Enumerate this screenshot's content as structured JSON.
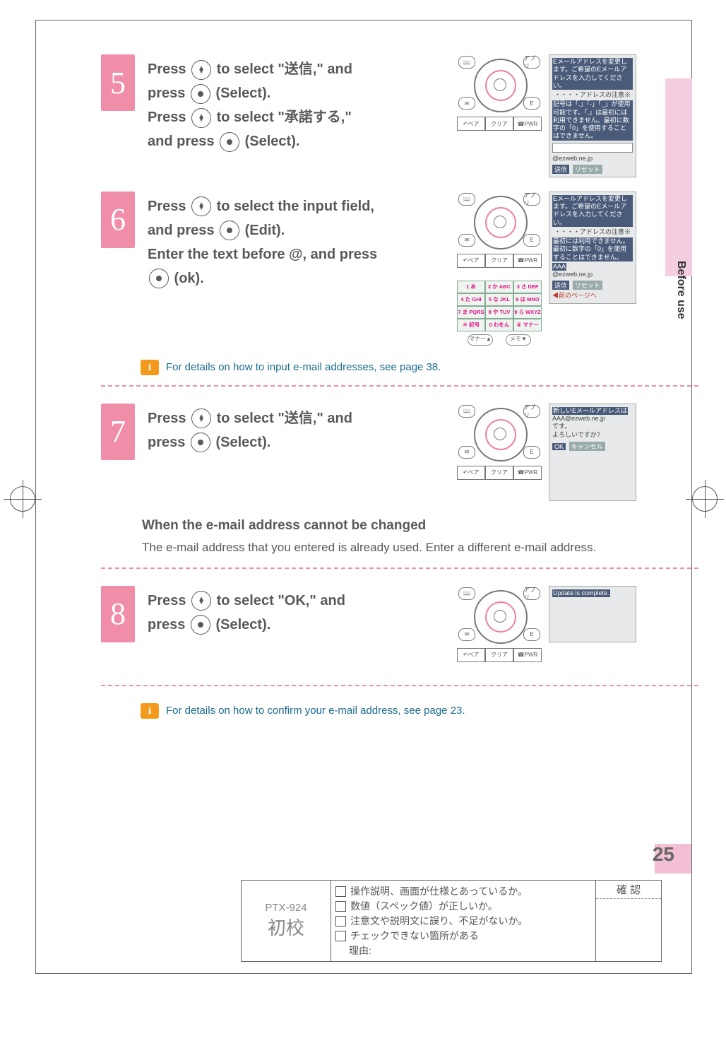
{
  "sideTab": "Before use",
  "pageNumber": "25",
  "steps": {
    "5": {
      "num": "5",
      "lines": [
        "Press |arrows| to select \"送信,\" and",
        "press |dot| (Select).",
        "Press |arrows| to select \"承諾する,\"",
        "and press |dot| (Select)."
      ],
      "screen": {
        "top": "Eメールアドレスを変更します。ご希望のEメールアドレスを入力してください。",
        "band": "・・・・アドレスの注意※",
        "mid": "記号は「.」「-」「_」が使用可能です。「.」は最初には利用できません。最初に数字の「0」を使用することはできません。",
        "domain": "@ezweb.ne.jp",
        "buttons": [
          "送信",
          "リセット"
        ]
      }
    },
    "6": {
      "num": "6",
      "lines": [
        "Press |arrows| to select the input field,",
        "and press |dot| (Edit).",
        "Enter the text before @, and press",
        "|dot| (ok)."
      ],
      "screen": {
        "top": "Eメールアドレスを変更します。ご希望のEメールアドレスを入力してください。",
        "band": "・・・・アドレスの注意※",
        "mid": "最初には利用できません。最初に数字の「0」を使用することはできません。",
        "input": "AAA",
        "domain": "@ezweb.ne.jp",
        "buttons": [
          "送信",
          "リセット"
        ],
        "link": "◀前のページへ"
      },
      "note": "For details on how to input e-mail addresses, see page 38."
    },
    "7": {
      "num": "7",
      "lines": [
        "Press |arrows| to select \"送信,\" and",
        "press |dot| (Select)."
      ],
      "screen": {
        "top": "新しいEメールアドレスは",
        "addr": "AAA@ezweb.ne.jp",
        "body": "です。\nよろしいですか?",
        "buttons": [
          "OK",
          "キャンセル"
        ]
      },
      "subTitle": "When the e-mail address cannot be changed",
      "subBody": "The e-mail address that you entered is already used. Enter a different e-mail address."
    },
    "8": {
      "num": "8",
      "lines": [
        "Press |arrows| to select \"OK,\" and",
        "press |dot| (Select)."
      ],
      "screen": {
        "msg": "Update is complete."
      },
      "note": "For details on how to confirm your e-mail address, see page 23."
    }
  },
  "phoneBar": {
    "left": "ペア",
    "mid": "クリア",
    "right": "PWR"
  },
  "phonePills": {
    "tl": "📖",
    "tr": "アプリ",
    "bl": "✉",
    "br": "E"
  },
  "keypad": [
    [
      "1 あ",
      "2 か ABC",
      "3 さ DEF"
    ],
    [
      "4 た GHI",
      "5 な JKL",
      "6 は MNO"
    ],
    [
      "7 ま PQRS",
      "8 や TUV",
      "9 ら WXYZ"
    ],
    [
      "＊ 記号",
      "0 わをん",
      "＃ マナー"
    ]
  ],
  "proof": {
    "model": "PTX-924",
    "stage": "初校",
    "checks": [
      "操作説明、画面が仕様とあっているか。",
      "数値（スペック値）が正しいか。",
      "注意文や説明文に誤り、不足がないか。",
      "チェックできない箇所がある",
      "理由:"
    ],
    "confirm": "確 認"
  }
}
